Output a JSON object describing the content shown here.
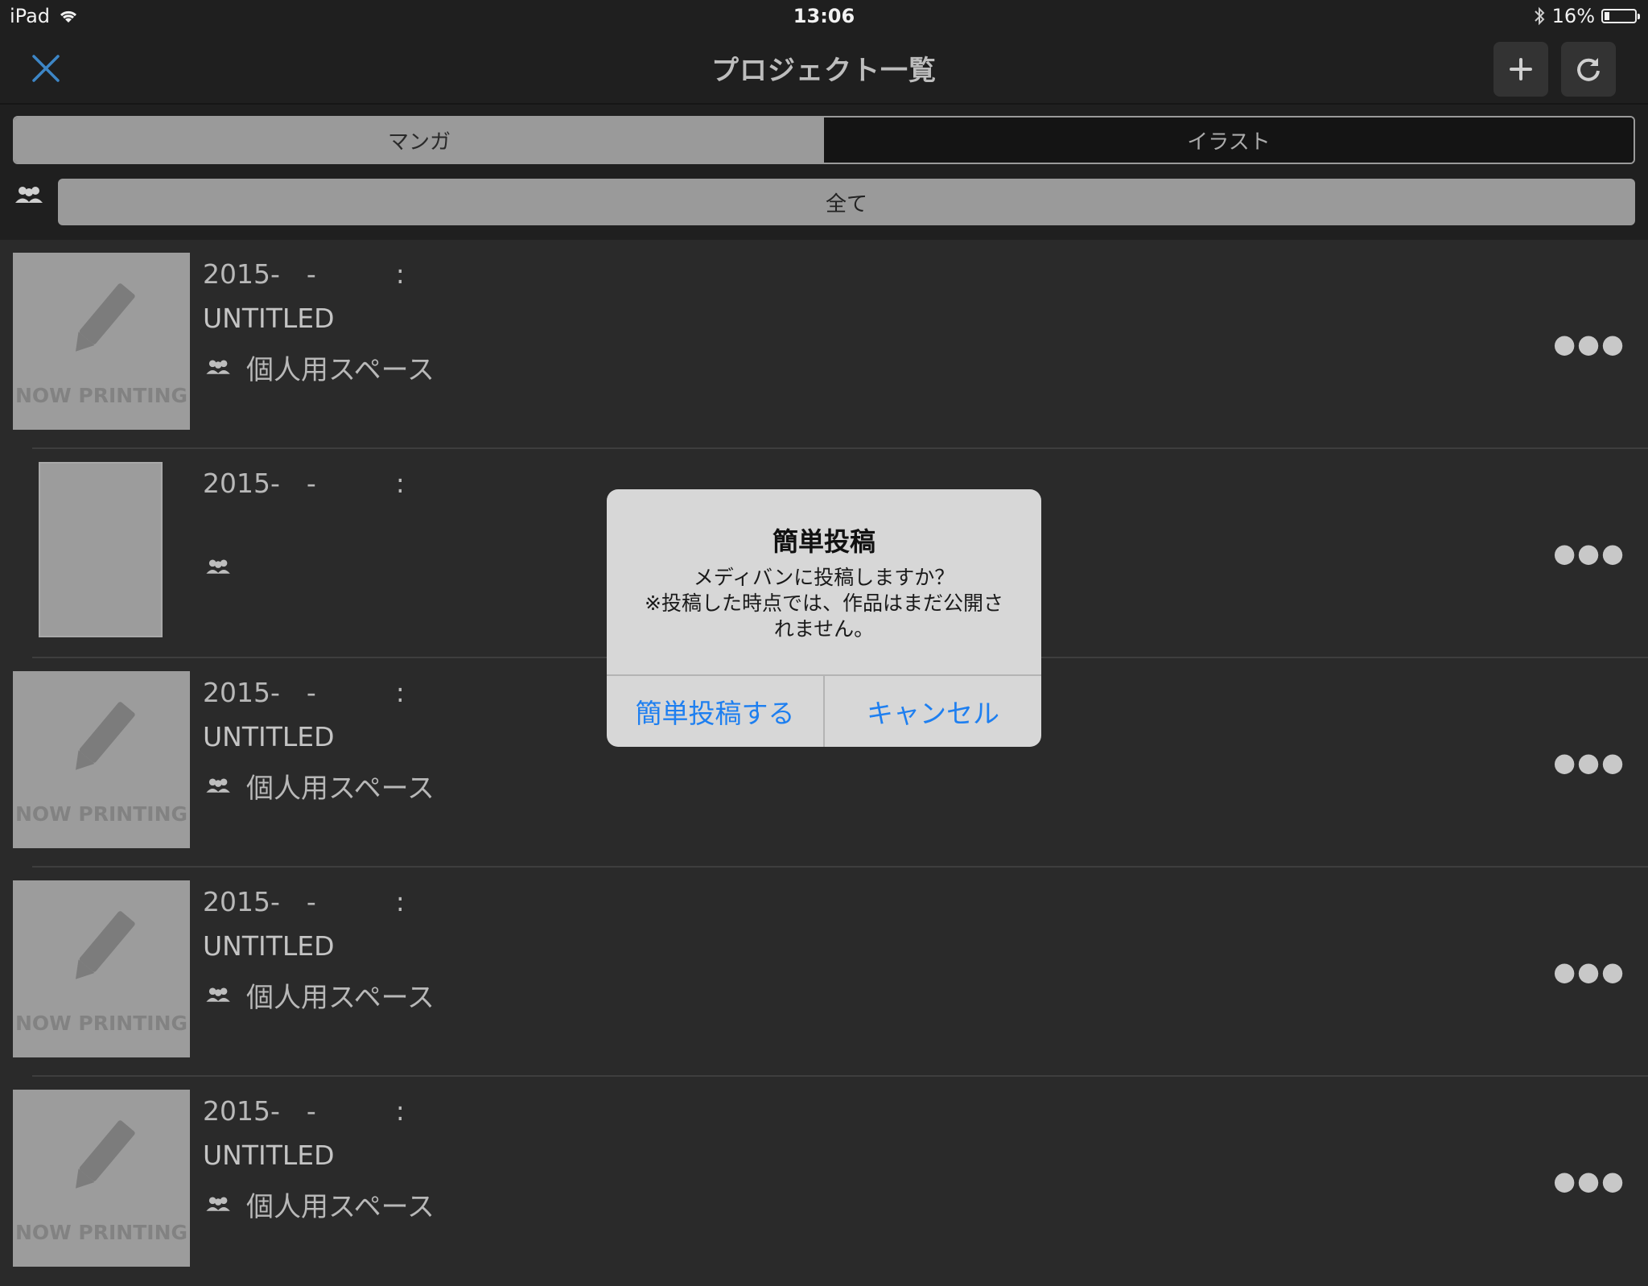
{
  "status_bar": {
    "device": "iPad",
    "time": "13:06",
    "battery": "16%",
    "battery_level": 0.16
  },
  "nav": {
    "title": "プロジェクト一覧"
  },
  "segments": {
    "manga": "マンガ",
    "illust": "イラスト"
  },
  "filter": {
    "label": "全て"
  },
  "thumb_text": "NOW PRINTING",
  "items": [
    {
      "date": "2015-　-　　　:",
      "title": "UNTITLED",
      "space": "個人用スペース"
    },
    {
      "date": "2015-　-　　　:",
      "title": "",
      "space": ""
    },
    {
      "date": "2015-　-　　　:",
      "title": "UNTITLED",
      "space": "個人用スペース"
    },
    {
      "date": "2015-　-　　　:",
      "title": "UNTITLED",
      "space": "個人用スペース"
    },
    {
      "date": "2015-　-　　　:",
      "title": "UNTITLED",
      "space": "個人用スペース"
    }
  ],
  "more_label": "●●●",
  "alert": {
    "title": "簡単投稿",
    "message": "メディバンに投稿しますか？\n※投稿した時点では、作品はまだ公開さ\nれません。",
    "confirm": "簡単投稿する",
    "cancel": "キャンセル"
  },
  "colors": {
    "accent": "#1e7ff0",
    "background": "#2a2a2a",
    "bar": "#1f1f1f"
  }
}
